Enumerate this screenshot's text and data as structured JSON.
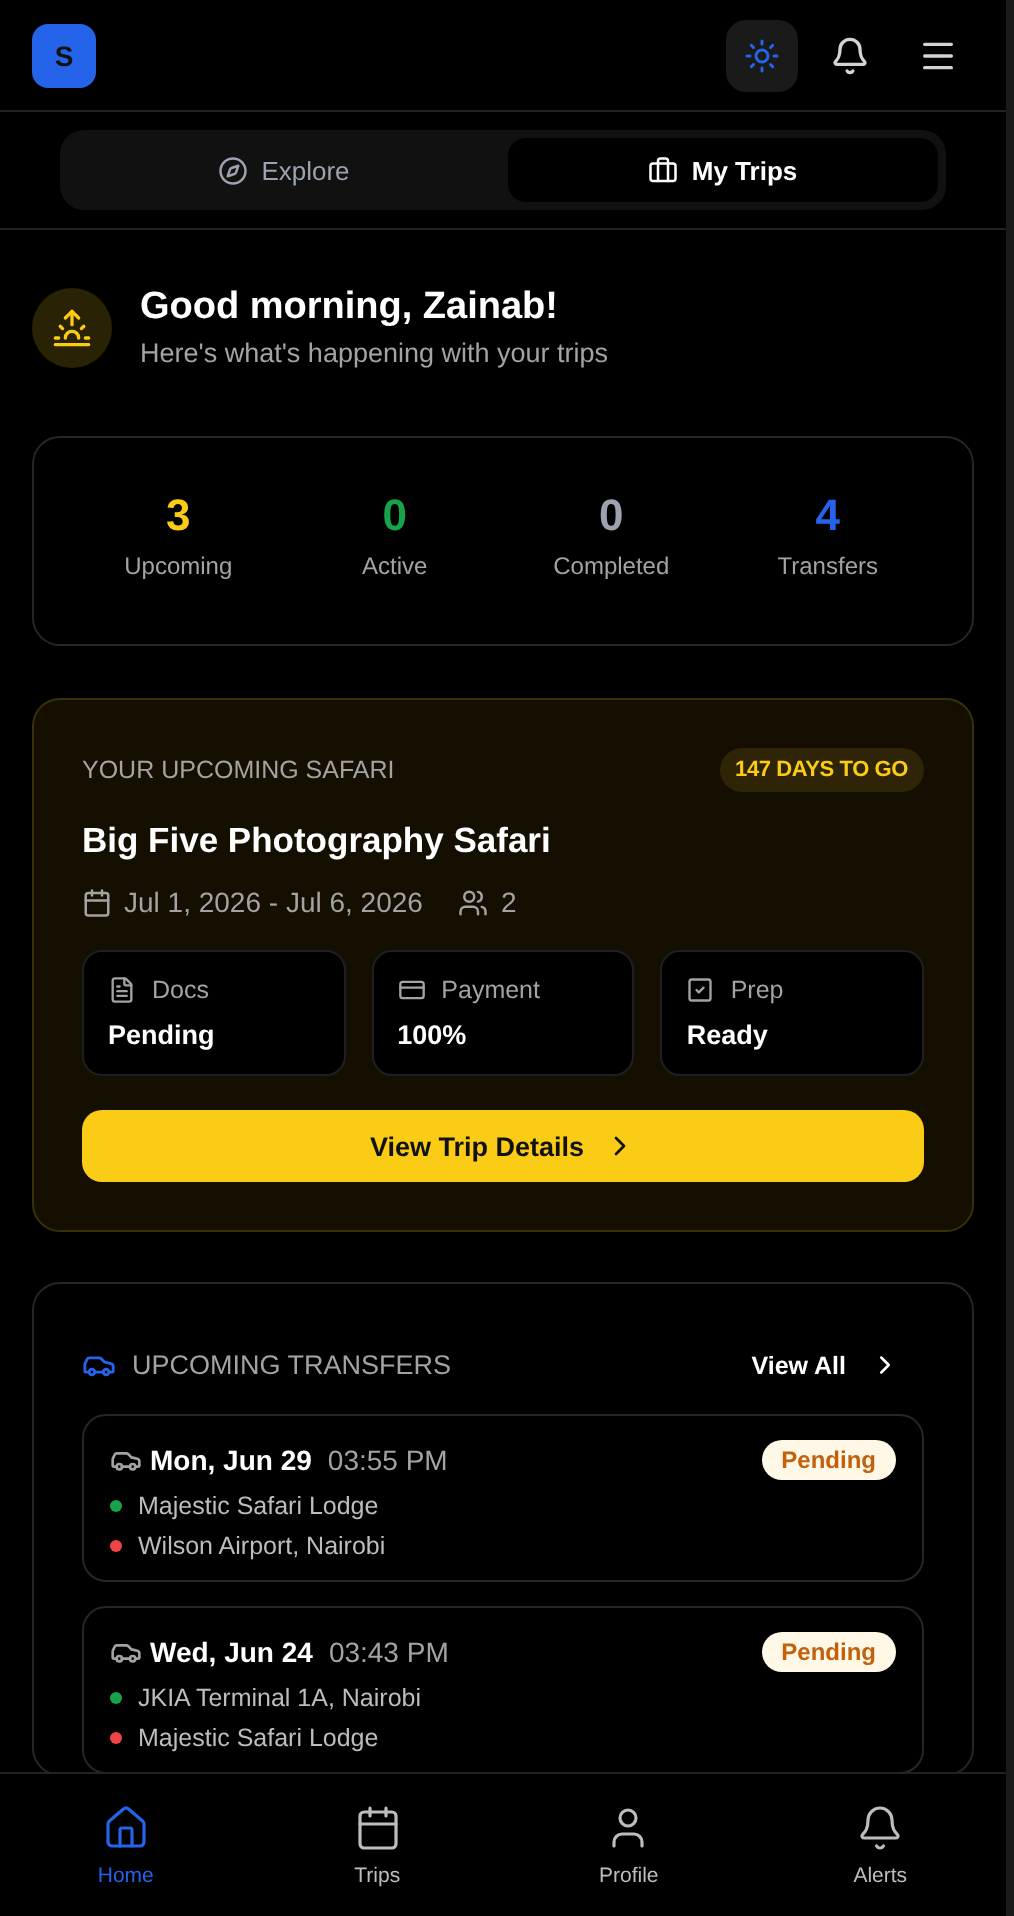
{
  "header": {
    "logo": "S",
    "theme_toggle": {
      "on": true
    }
  },
  "tabs": [
    {
      "label": "Explore",
      "selected": false
    },
    {
      "label": "My Trips",
      "selected": true
    }
  ],
  "greeting": {
    "title": "Good morning, Zainab!",
    "subtitle": "Here's what's happening with your trips"
  },
  "stats": [
    {
      "value": "3",
      "label": "Upcoming",
      "color": "#facc15"
    },
    {
      "value": "0",
      "label": "Active",
      "color": "#16a34a"
    },
    {
      "value": "0",
      "label": "Completed",
      "color": "#9ca3af"
    },
    {
      "value": "4",
      "label": "Transfers",
      "color": "#2563eb"
    }
  ],
  "upcoming_safari": {
    "eyebrow": "YOUR UPCOMING SAFARI",
    "countdown": "147 DAYS TO GO",
    "title": "Big Five Photography Safari",
    "dates": "Jul 1, 2026 - Jul 6, 2026",
    "guests": "2",
    "checks": [
      {
        "label": "Docs",
        "value": "Pending"
      },
      {
        "label": "Payment",
        "value": "100%"
      },
      {
        "label": "Prep",
        "value": "Ready"
      }
    ],
    "button": "View Trip Details"
  },
  "transfers": {
    "title": "UPCOMING TRANSFERS",
    "view_all": "View All",
    "items": [
      {
        "date": "Mon, Jun 29",
        "time": "03:55 PM",
        "status": "Pending",
        "stops": [
          {
            "name": "Majestic Safari Lodge",
            "color": "#16a34a"
          },
          {
            "name": "Wilson Airport, Nairobi",
            "color": "#ef4444"
          }
        ]
      },
      {
        "date": "Wed, Jun 24",
        "time": "03:43 PM",
        "status": "Pending",
        "stops": [
          {
            "name": "JKIA Terminal 1A, Nairobi",
            "color": "#16a34a"
          },
          {
            "name": "Majestic Safari Lodge",
            "color": "#ef4444"
          }
        ]
      }
    ]
  },
  "bottom_nav": [
    {
      "label": "Home",
      "selected": true
    },
    {
      "label": "Trips",
      "selected": false
    },
    {
      "label": "Profile",
      "selected": false
    },
    {
      "label": "Alerts",
      "selected": false
    }
  ]
}
